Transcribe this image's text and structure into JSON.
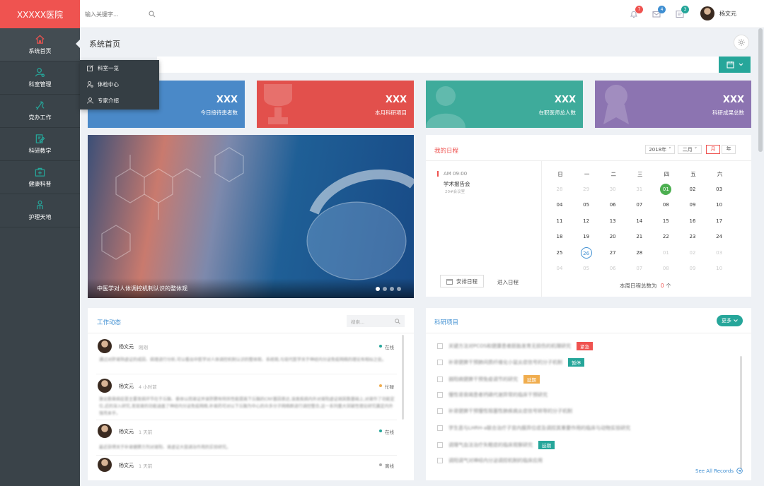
{
  "app": {
    "brand": "XXXXX医院"
  },
  "sidebar": {
    "items": [
      {
        "label": "系统首页",
        "icon": "home-icon"
      },
      {
        "label": "科室管理",
        "icon": "users-gear-icon"
      },
      {
        "label": "党办工作",
        "icon": "flag-icon"
      },
      {
        "label": "科研教学",
        "icon": "edit-doc-icon"
      },
      {
        "label": "健康科普",
        "icon": "medical-kit-icon"
      },
      {
        "label": "护理天地",
        "icon": "person-icon"
      }
    ]
  },
  "submenu": {
    "items": [
      {
        "label": "科室一览",
        "icon": "edit-icon"
      },
      {
        "label": "体检中心",
        "icon": "user-search-icon"
      },
      {
        "label": "专家介绍",
        "icon": "user-icon"
      }
    ]
  },
  "topbar": {
    "search_placeholder": "输入关键字...",
    "notifications": {
      "count": "7",
      "color": "#ef5350"
    },
    "mail": {
      "count": "4",
      "color": "#3f8fd2"
    },
    "messages": {
      "count": "3",
      "color": "#26a69a"
    },
    "user_name": "杨文元"
  },
  "page": {
    "title": "系统首页"
  },
  "stats": [
    {
      "value": "XXX",
      "label": "今日接待患者数",
      "color": "#4a89c8"
    },
    {
      "value": "XXX",
      "label": "本月科研项目",
      "color": "#e2504c"
    },
    {
      "value": "XXX",
      "label": "在职医师总人数",
      "color": "#3eab9b"
    },
    {
      "value": "XXX",
      "label": "科研成果总数",
      "color": "#8c74b1"
    }
  ],
  "carousel": {
    "caption": "中医学对人体调控机制认识的整体观",
    "slides": 4,
    "active": 1
  },
  "schedule": {
    "title": "我的日程",
    "year": "2018年",
    "month": "二月",
    "view_month": "月",
    "view_year": "年",
    "event_time": "AM 09:00",
    "event_title": "学术报告会",
    "event_place": "20#会议室",
    "arrange_button": "安排日程",
    "enter_button": "进入日程",
    "week_count_label": "本周日程总数为",
    "week_count": "0",
    "week_count_unit": "个",
    "weekdays": [
      "日",
      "一",
      "二",
      "三",
      "四",
      "五",
      "六"
    ],
    "days": [
      [
        "28",
        "29",
        "30",
        "31",
        "01",
        "02",
        "03"
      ],
      [
        "04",
        "05",
        "06",
        "07",
        "08",
        "09",
        "10"
      ],
      [
        "11",
        "12",
        "13",
        "14",
        "15",
        "16",
        "17"
      ],
      [
        "18",
        "19",
        "20",
        "21",
        "22",
        "23",
        "24"
      ],
      [
        "25",
        "26",
        "27",
        "28",
        "01",
        "02",
        "03"
      ],
      [
        "04",
        "05",
        "06",
        "07",
        "08",
        "09",
        "10"
      ]
    ]
  },
  "work": {
    "title": "工作动态",
    "search_placeholder": "搜索...",
    "items": [
      {
        "name": "杨文元",
        "time": "刚刚",
        "status": "在线",
        "status_color": "#26a69a",
        "text": "通过对肝肾阴虚证的成因、病理进行分析,可以看出中医学对人体调控机制认识的整体观、系统观,与现代医学关于神经内分泌免疫网络的理论有相似之处。"
      },
      {
        "name": "杨文元",
        "time": "4 小时前",
        "status": "忙碌",
        "status_color": "#f0ad4e",
        "text": "激论筋骨病症是主要发病环节在于丘脑、垂体以而肾证并录肝脾有特异性能提高下丘脑的CRF基因表达,该类疾病内外对肾阳虚证胡其数基础上,对肾作了功能定位,近的深入研究,发现肾的功能涵盖了神经内分泌免疫网络,补肾药可对以下丘脑为中心的众多分子网络群进行调控整合,这一系列重大突破性理论研究奠定内外强壳本乎。"
      },
      {
        "name": "杨文元",
        "time": "1 天前",
        "status": "在线",
        "status_color": "#26a69a",
        "text": "最近获得关于补肾健脾方剂对肾阳、肾虚证大鼠调治作用的实验研究。"
      },
      {
        "name": "杨文元",
        "time": "1 天前",
        "status": "离线",
        "status_color": "#aaaaaa",
        "text": ""
      }
    ]
  },
  "projects": {
    "title": "科研项目",
    "more_button": "更多",
    "see_all": "See All Records",
    "items": [
      {
        "text": "关键方法对PCOS和健康患者胚胎发育无损伤的机理研究",
        "tag": "紧急",
        "tag_color": "#ef5350"
      },
      {
        "text": "补肾健脾干预肺间质纤维化小鼠炎症信号的分子机制",
        "tag": "暂停",
        "tag_color": "#26a69a"
      },
      {
        "text": "弱阳病健脾干预免疫调节的研究",
        "tag": "延期",
        "tag_color": "#f0ad4e"
      },
      {
        "text": "慢性肾衰竭患者钙磷代谢异常的临床干预研究",
        "tag": "",
        "tag_color": ""
      },
      {
        "text": "补肾健脾干预慢性阻塞性肺疾病炎症信号转导的分子机制",
        "tag": "",
        "tag_color": ""
      },
      {
        "text": "学生恶与LHRH-a联合治疗子宫内膜异位症及调控其重要作用的临床与动物实验研究",
        "tag": "",
        "tag_color": ""
      },
      {
        "text": "调理气血法治疗失眠症的临床观察研究",
        "tag": "延期",
        "tag_color": "#26a69a"
      },
      {
        "text": "调阳调气对神经内分泌调控机制的临床应用",
        "tag": "",
        "tag_color": ""
      }
    ]
  }
}
